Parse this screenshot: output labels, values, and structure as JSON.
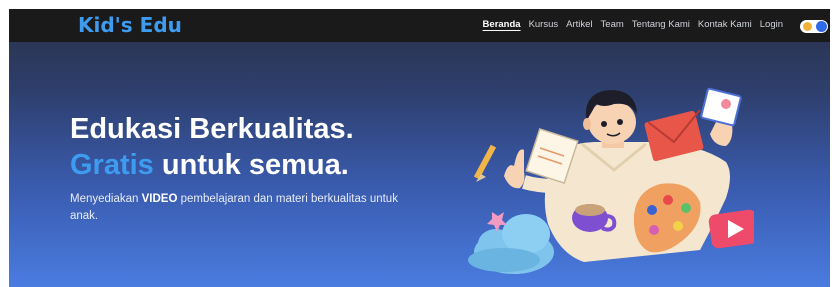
{
  "brand": "Kid's Edu",
  "nav": {
    "items": [
      "Beranda",
      "Kursus",
      "Artikel",
      "Team",
      "Tentang Kami",
      "Kontak Kami",
      "Login"
    ],
    "active": "Beranda"
  },
  "theme_toggle": {
    "state": "dark",
    "sun_icon": "sun-icon"
  },
  "hero": {
    "title_line1": "Edukasi Berkualitas.",
    "title_line2_highlight": "Gratis",
    "title_line2_rest": " untuk semua.",
    "desc_before": "Menyediakan ",
    "desc_bold": "VIDEO",
    "desc_after": " pembelajaran dan materi berkualitas untuk anak."
  },
  "colors": {
    "accent": "#3d9cf0",
    "navbar": "#1a1a1a",
    "gradient_top": "#2a3046",
    "gradient_bottom": "#4a7ce0"
  }
}
